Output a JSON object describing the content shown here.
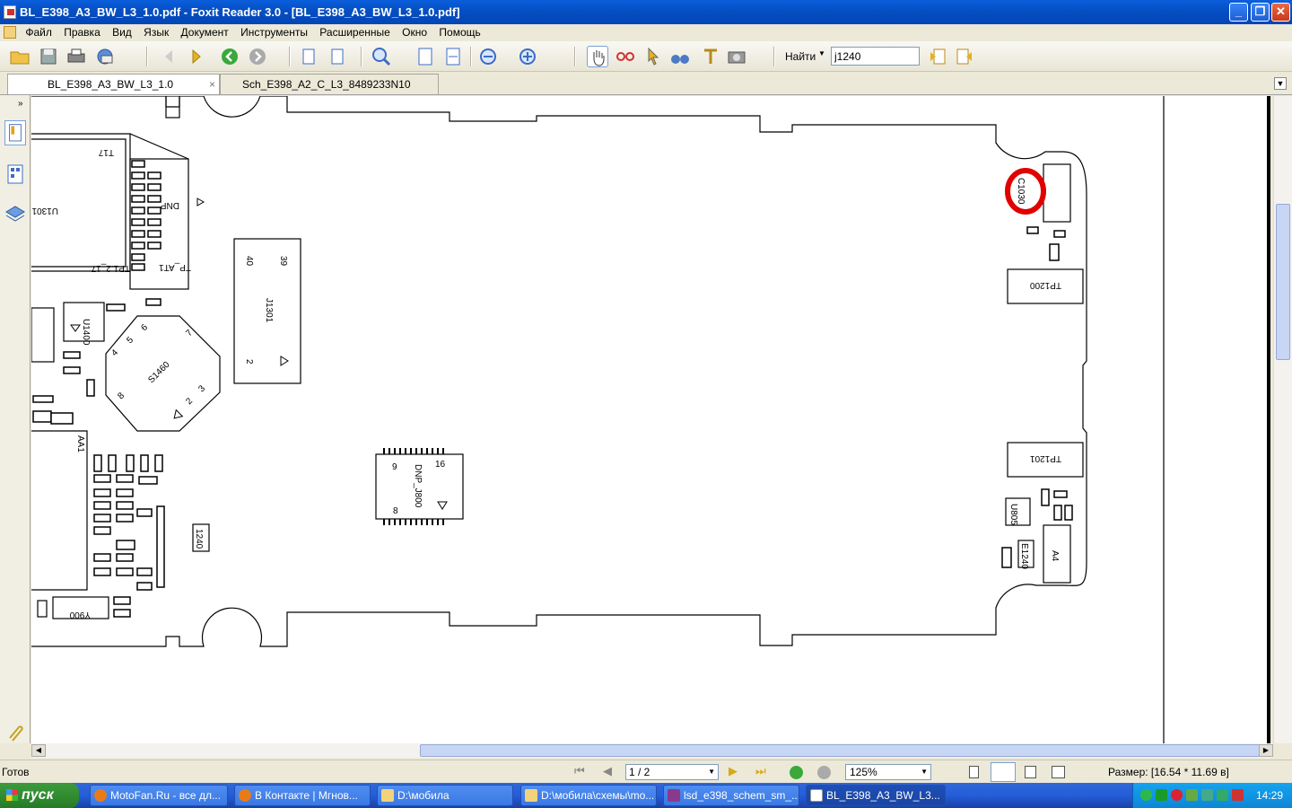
{
  "window": {
    "title": "BL_E398_A3_BW_L3_1.0.pdf - Foxit Reader 3.0 - [BL_E398_A3_BW_L3_1.0.pdf]"
  },
  "menu": [
    "Файл",
    "Правка",
    "Вид",
    "Язык",
    "Документ",
    "Инструменты",
    "Расширенные",
    "Окно",
    "Помощь"
  ],
  "find": {
    "label": "Найти",
    "value": "j1240"
  },
  "tabs": [
    {
      "label": "BL_E398_A3_BW_L3_1.0",
      "close": "×"
    },
    {
      "label": "Sch_E398_A2_C_L3_8489233N10"
    }
  ],
  "document": {
    "labels": [
      "U1301",
      "T17",
      "DNP",
      "TP_AT1",
      "TP1.2_17",
      "U1400",
      "J1301",
      "39",
      "40",
      "2",
      "S1460",
      "7",
      "6",
      "5",
      "4",
      "3",
      "2",
      "8",
      "AA1",
      "DNP_J800",
      "16",
      "9",
      "8",
      "1240",
      "Y900",
      "TP1200",
      "TP1201",
      "C1030",
      "A4",
      "E1240",
      "U805"
    ]
  },
  "status": {
    "ready": "Готов",
    "page": "1 / 2",
    "zoom": "125%",
    "size": "Размер: [16.54 * 11.69 в]"
  },
  "taskbar": {
    "start": "пуск",
    "tasks": [
      {
        "label": "MotoFan.Ru - все дл..."
      },
      {
        "label": "В Контакте | Мгнов..."
      },
      {
        "label": "D:\\мобила"
      },
      {
        "label": "D:\\мобила\\схемы\\mo..."
      },
      {
        "label": "lsd_e398_schem_sm_..."
      },
      {
        "label": "BL_E398_A3_BW_L3..."
      }
    ],
    "clock": "14:29"
  },
  "colors": {
    "highlight": "#e00000",
    "accent": "#0a5fdd"
  }
}
